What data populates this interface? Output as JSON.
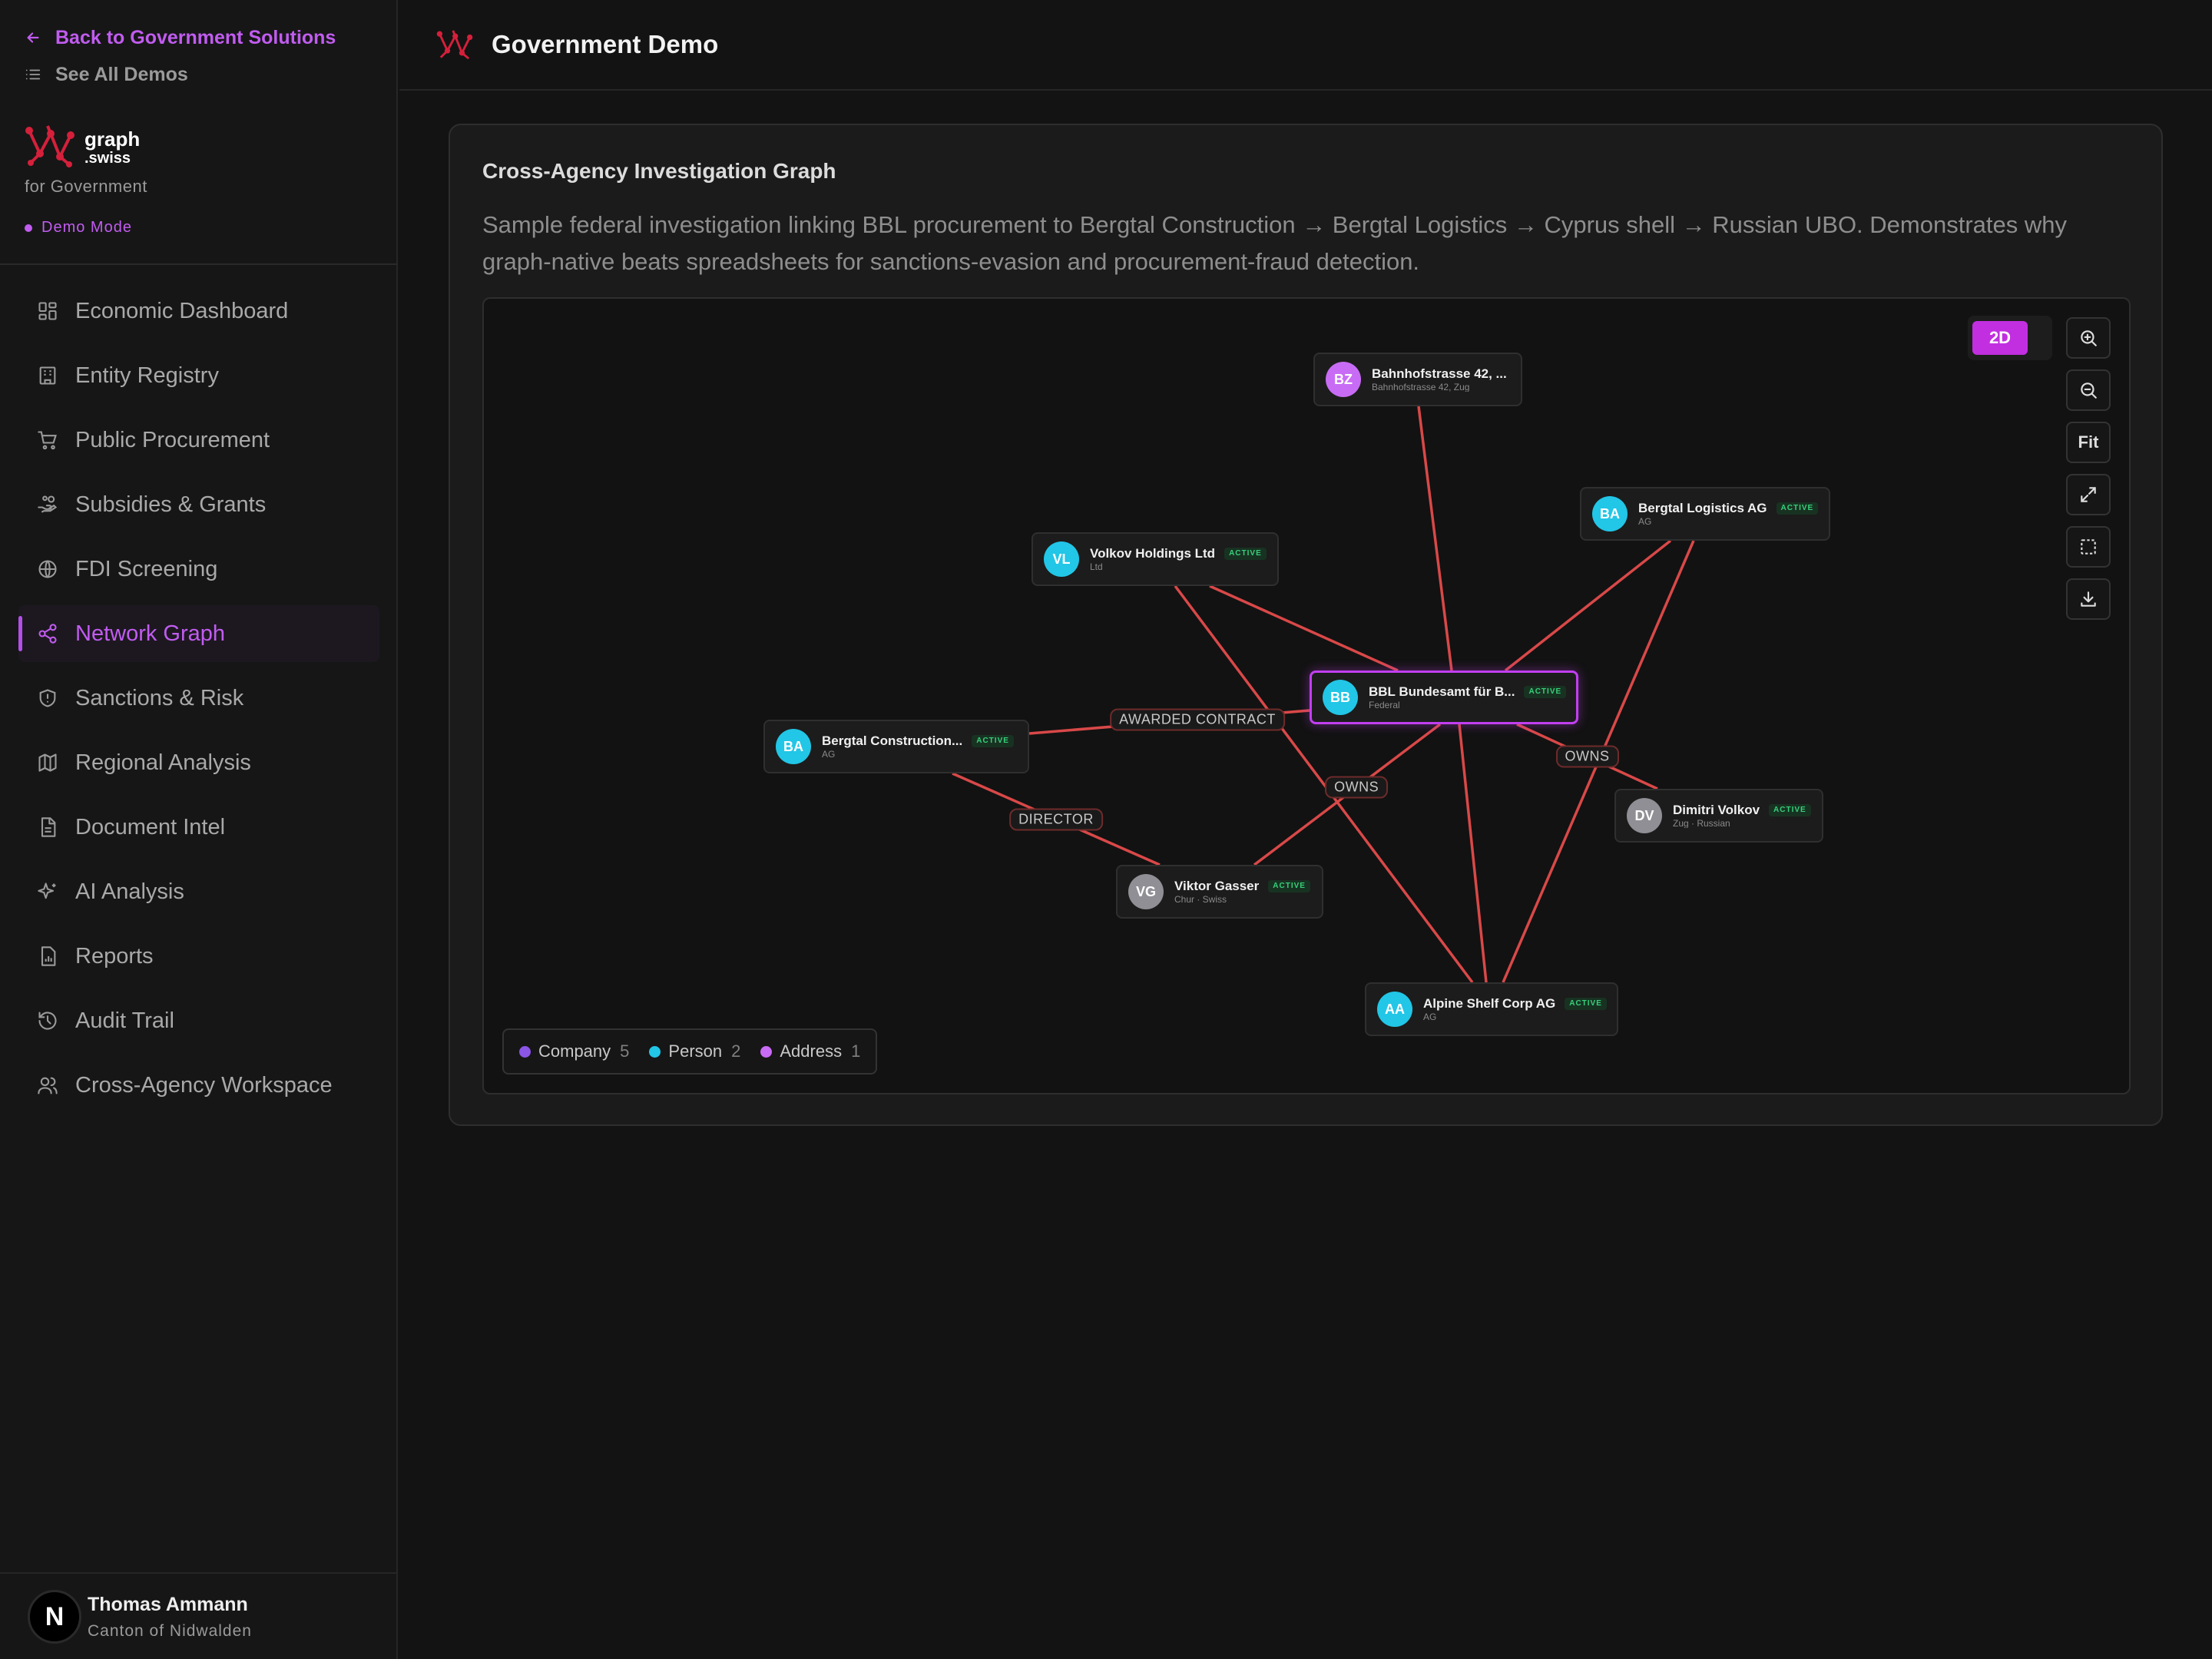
{
  "sidebar": {
    "back_label": "Back to Government Solutions",
    "all_demos_label": "See All Demos",
    "brand_line1": "graph",
    "brand_line2": ".swiss",
    "brand_sub": "for Government",
    "mode_label": "Demo Mode",
    "nav": [
      {
        "label": "Economic Dashboard",
        "icon": "dashboard-icon"
      },
      {
        "label": "Entity Registry",
        "icon": "building-icon"
      },
      {
        "label": "Public Procurement",
        "icon": "cart-icon"
      },
      {
        "label": "Subsidies & Grants",
        "icon": "hand-coins-icon"
      },
      {
        "label": "FDI Screening",
        "icon": "globe-icon"
      },
      {
        "label": "Network Graph",
        "icon": "share-icon",
        "active": true
      },
      {
        "label": "Sanctions & Risk",
        "icon": "shield-icon"
      },
      {
        "label": "Regional Analysis",
        "icon": "map-icon"
      },
      {
        "label": "Document Intel",
        "icon": "document-icon"
      },
      {
        "label": "AI Analysis",
        "icon": "sparkles-icon"
      },
      {
        "label": "Reports",
        "icon": "report-icon"
      },
      {
        "label": "Audit Trail",
        "icon": "history-icon"
      },
      {
        "label": "Cross-Agency Workspace",
        "icon": "users-icon"
      }
    ],
    "user": {
      "initial": "N",
      "name": "Thomas Ammann",
      "org": "Canton of Nidwalden"
    }
  },
  "header": {
    "title": "Government Demo"
  },
  "card": {
    "title": "Cross-Agency Investigation Graph",
    "description": "Sample federal investigation linking BBL procurement to Bergtal Construction → Bergtal Logistics → Cyprus shell → Russian UBO. Demonstrates why graph-native beats spreadsheets for sanctions-evasion and procurement-fraud detection."
  },
  "graph": {
    "view_mode": "2D",
    "fit_label": "Fit",
    "colors": {
      "company": "#22c6e6",
      "person_gray": "#8f8f95",
      "address": "#c86cf5",
      "edge": "#d94848",
      "accent": "#c13ff0",
      "legend_company": "#8b55e6",
      "legend_person": "#22c6e6",
      "legend_address": "#c86cf5"
    },
    "nodes": [
      {
        "id": "bz",
        "initials": "BZ",
        "name": "Bahnhofstrasse 42, ...",
        "sub": "Bahnhofstrasse 42, Zug",
        "badge": "",
        "color": "#c86cf5"
      },
      {
        "id": "bl",
        "initials": "BA",
        "name": "Bergtal Logistics AG",
        "sub": "AG",
        "badge": "ACTIVE",
        "color": "#22c6e6"
      },
      {
        "id": "vh",
        "initials": "VL",
        "name": "Volkov Holdings Ltd",
        "sub": "Ltd",
        "badge": "ACTIVE",
        "color": "#22c6e6"
      },
      {
        "id": "bbl",
        "initials": "BB",
        "name": "BBL Bundesamt für B...",
        "sub": "Federal",
        "badge": "ACTIVE",
        "color": "#22c6e6",
        "selected": true
      },
      {
        "id": "bc",
        "initials": "BA",
        "name": "Bergtal Construction...",
        "sub": "AG",
        "badge": "ACTIVE",
        "color": "#22c6e6"
      },
      {
        "id": "dv",
        "initials": "DV",
        "name": "Dimitri Volkov",
        "sub": "Zug · Russian",
        "badge": "ACTIVE",
        "color": "#8f8f95"
      },
      {
        "id": "vg",
        "initials": "VG",
        "name": "Viktor Gasser",
        "sub": "Chur · Swiss",
        "badge": "ACTIVE",
        "color": "#8f8f95"
      },
      {
        "id": "as",
        "initials": "AA",
        "name": "Alpine Shelf Corp AG",
        "sub": "AG",
        "badge": "ACTIVE",
        "color": "#22c6e6"
      }
    ],
    "edges": [
      {
        "from": "bz",
        "to": "bbl",
        "label": ""
      },
      {
        "from": "bl",
        "to": "bbl",
        "label": ""
      },
      {
        "from": "bl",
        "to": "as",
        "label": ""
      },
      {
        "from": "vh",
        "to": "bbl",
        "label": ""
      },
      {
        "from": "vh",
        "to": "as",
        "label": ""
      },
      {
        "from": "bc",
        "to": "bbl",
        "label": "AWARDED CONTRACT"
      },
      {
        "from": "bc",
        "to": "vg",
        "label": "DIRECTOR"
      },
      {
        "from": "vg",
        "to": "bbl",
        "label": "OWNS"
      },
      {
        "from": "dv",
        "to": "bbl",
        "label": "OWNS"
      },
      {
        "from": "bbl",
        "to": "as",
        "label": ""
      }
    ],
    "legend": [
      {
        "label": "Company",
        "count": "5",
        "color": "#8b55e6"
      },
      {
        "label": "Person",
        "count": "2",
        "color": "#22c6e6"
      },
      {
        "label": "Address",
        "count": "1",
        "color": "#c86cf5"
      }
    ]
  }
}
